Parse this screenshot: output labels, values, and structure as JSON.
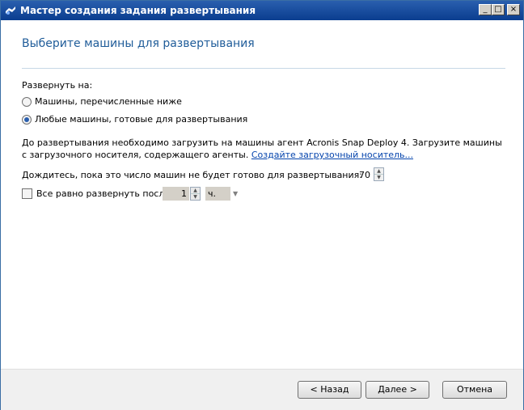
{
  "window": {
    "title": "Мастер создания задания развертывания",
    "controls": {
      "minimize": "_",
      "maximize": "□",
      "close": "×"
    }
  },
  "page": {
    "heading": "Выберите машины для развертывания",
    "deploy_to_label": "Развернуть на:",
    "options": [
      {
        "label": "Машины, перечисленные ниже",
        "selected": false
      },
      {
        "label": "Любые машины, готовые для развертывания",
        "selected": true
      }
    ],
    "info_text": "До развертывания необходимо загрузить на машины агент Acronis Snap Deploy 4. Загрузите машины с загрузочного носителя, содержащего агенты.",
    "info_link": "Создайте загрузочный носитель...",
    "wait_label": "Дождитесь, пока это число машин не будет готово для развертывания:",
    "wait_value": "70",
    "deploy_after_label": "Все равно развернуть после:",
    "deploy_after_checked": false,
    "deploy_after_value": "1",
    "deploy_after_unit": "ч."
  },
  "footer": {
    "back_label": "< Назад",
    "next_label": "Далее >",
    "cancel_label": "Отмена"
  },
  "icons": {
    "window": "wizard-icon",
    "spinner_up": "▲",
    "spinner_down": "▼",
    "dropdown": "▼"
  }
}
